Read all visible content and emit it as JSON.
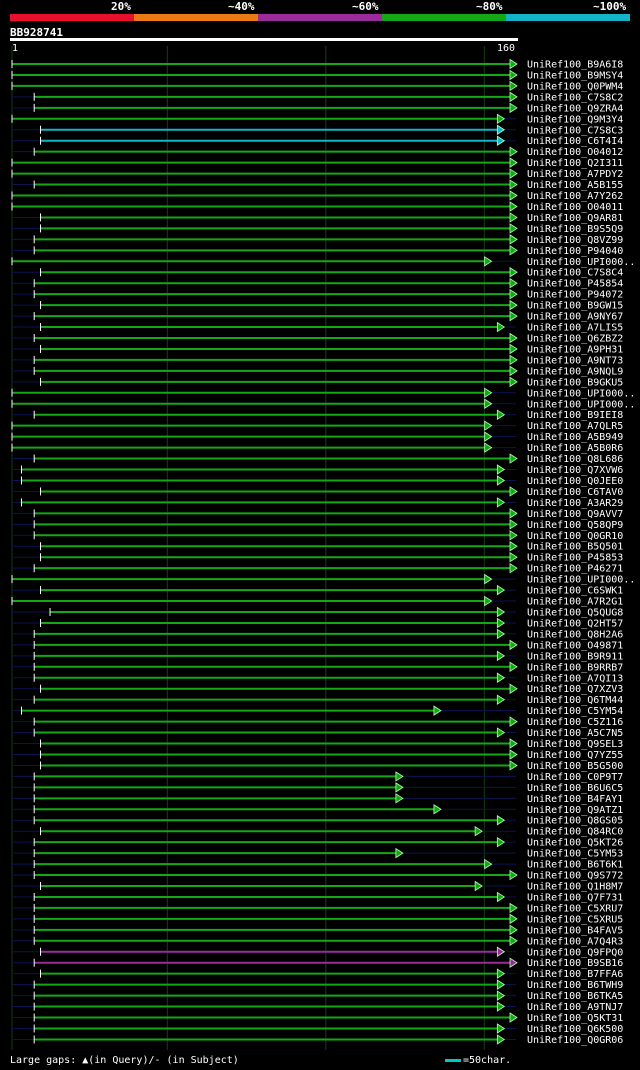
{
  "legend": [
    {
      "label": "20%",
      "color": "#e8102a"
    },
    {
      "label": "~40%",
      "color": "#ec7a14"
    },
    {
      "label": "~60%",
      "color": "#9b2a9b"
    },
    {
      "label": "~80%",
      "color": "#14a814"
    },
    {
      "label": "~100%",
      "color": "#14b4c8"
    }
  ],
  "query": {
    "name": "BB928741",
    "start_label": "1",
    "end_label": "160"
  },
  "footer": {
    "gaps_text": "Large gaps: ▲(in Query)/- (in Subject)",
    "scale_text": "=50char."
  },
  "chart_data": {
    "type": "alignment",
    "query_length": 160,
    "hits": [
      {
        "name": "UniRef100_B9A6I8",
        "start": 1,
        "end": 160,
        "identity": "~80%"
      },
      {
        "name": "UniRef100_B9MSY4",
        "start": 1,
        "end": 160,
        "identity": "~80%"
      },
      {
        "name": "UniRef100_Q0PWM4",
        "start": 1,
        "end": 160,
        "identity": "~80%"
      },
      {
        "name": "UniRef100_C7S8C2",
        "start": 8,
        "end": 160,
        "identity": "~80%"
      },
      {
        "name": "UniRef100_Q9ZRA4",
        "start": 8,
        "end": 160,
        "identity": "~80%"
      },
      {
        "name": "UniRef100_Q9M3Y4",
        "start": 1,
        "end": 156,
        "identity": "~80%"
      },
      {
        "name": "UniRef100_C7S8C3",
        "start": 10,
        "end": 156,
        "identity": "~100%"
      },
      {
        "name": "UniRef100_C6T4I4",
        "start": 10,
        "end": 156,
        "identity": "~100%"
      },
      {
        "name": "UniRef100_O04012",
        "start": 8,
        "end": 160,
        "identity": "~80%"
      },
      {
        "name": "UniRef100_Q2I311",
        "start": 1,
        "end": 160,
        "identity": "~80%"
      },
      {
        "name": "UniRef100_A7PDY2",
        "start": 1,
        "end": 160,
        "identity": "~80%"
      },
      {
        "name": "UniRef100_A5B155",
        "start": 8,
        "end": 160,
        "identity": "~80%"
      },
      {
        "name": "UniRef100_A7Y262",
        "start": 1,
        "end": 160,
        "identity": "~80%"
      },
      {
        "name": "UniRef100_O04011",
        "start": 1,
        "end": 160,
        "identity": "~80%"
      },
      {
        "name": "UniRef100_Q9AR81",
        "start": 10,
        "end": 160,
        "identity": "~80%"
      },
      {
        "name": "UniRef100_B9S5Q9",
        "start": 10,
        "end": 160,
        "identity": "~80%"
      },
      {
        "name": "UniRef100_Q8VZ99",
        "start": 8,
        "end": 160,
        "identity": "~80%"
      },
      {
        "name": "UniRef100_P94040",
        "start": 8,
        "end": 160,
        "identity": "~80%"
      },
      {
        "name": "UniRef100_UPI000..",
        "start": 1,
        "end": 152,
        "identity": "~80%"
      },
      {
        "name": "UniRef100_C7S8C4",
        "start": 10,
        "end": 160,
        "identity": "~80%"
      },
      {
        "name": "UniRef100_P45854",
        "start": 8,
        "end": 160,
        "identity": "~80%"
      },
      {
        "name": "UniRef100_P94072",
        "start": 8,
        "end": 160,
        "identity": "~80%"
      },
      {
        "name": "UniRef100_B9GW15",
        "start": 10,
        "end": 160,
        "identity": "~80%"
      },
      {
        "name": "UniRef100_A9NY67",
        "start": 8,
        "end": 160,
        "identity": "~80%"
      },
      {
        "name": "UniRef100_A7LIS5",
        "start": 10,
        "end": 156,
        "identity": "~80%"
      },
      {
        "name": "UniRef100_Q6ZBZ2",
        "start": 8,
        "end": 160,
        "identity": "~80%"
      },
      {
        "name": "UniRef100_A9PH31",
        "start": 10,
        "end": 160,
        "identity": "~80%"
      },
      {
        "name": "UniRef100_A9NT73",
        "start": 8,
        "end": 160,
        "identity": "~80%"
      },
      {
        "name": "UniRef100_A9NQL9",
        "start": 8,
        "end": 160,
        "identity": "~80%"
      },
      {
        "name": "UniRef100_B9GKU5",
        "start": 10,
        "end": 160,
        "identity": "~80%"
      },
      {
        "name": "UniRef100_UPI000..",
        "start": 1,
        "end": 152,
        "identity": "~80%"
      },
      {
        "name": "UniRef100_UPI000..",
        "start": 1,
        "end": 152,
        "identity": "~80%"
      },
      {
        "name": "UniRef100_B9IEI8",
        "start": 8,
        "end": 156,
        "identity": "~80%"
      },
      {
        "name": "UniRef100_A7QLR5",
        "start": 1,
        "end": 152,
        "identity": "~80%"
      },
      {
        "name": "UniRef100_A5B949",
        "start": 1,
        "end": 152,
        "identity": "~80%"
      },
      {
        "name": "UniRef100_A5B0R6",
        "start": 1,
        "end": 152,
        "identity": "~80%"
      },
      {
        "name": "UniRef100_Q8L686",
        "start": 8,
        "end": 160,
        "identity": "~80%"
      },
      {
        "name": "UniRef100_Q7XVW6",
        "start": 4,
        "end": 156,
        "identity": "~80%"
      },
      {
        "name": "UniRef100_Q0JEE0",
        "start": 4,
        "end": 156,
        "identity": "~80%"
      },
      {
        "name": "UniRef100_C6TAV0",
        "start": 10,
        "end": 160,
        "identity": "~80%"
      },
      {
        "name": "UniRef100_A3AR29",
        "start": 4,
        "end": 156,
        "identity": "~80%"
      },
      {
        "name": "UniRef100_Q9AVV7",
        "start": 8,
        "end": 160,
        "identity": "~80%"
      },
      {
        "name": "UniRef100_Q58QP9",
        "start": 8,
        "end": 160,
        "identity": "~80%"
      },
      {
        "name": "UniRef100_Q0GR10",
        "start": 8,
        "end": 160,
        "identity": "~80%"
      },
      {
        "name": "UniRef100_B5Q501",
        "start": 10,
        "end": 160,
        "identity": "~80%"
      },
      {
        "name": "UniRef100_P45853",
        "start": 10,
        "end": 160,
        "identity": "~80%"
      },
      {
        "name": "UniRef100_P46271",
        "start": 8,
        "end": 160,
        "identity": "~80%"
      },
      {
        "name": "UniRef100_UPI000..",
        "start": 1,
        "end": 152,
        "identity": "~80%"
      },
      {
        "name": "UniRef100_C6SWK1",
        "start": 10,
        "end": 156,
        "identity": "~80%"
      },
      {
        "name": "UniRef100_A7R2G1",
        "start": 1,
        "end": 152,
        "identity": "~80%"
      },
      {
        "name": "UniRef100_Q5QUG8",
        "start": 13,
        "end": 156,
        "identity": "~80%"
      },
      {
        "name": "UniRef100_Q2HT57",
        "start": 10,
        "end": 156,
        "identity": "~80%"
      },
      {
        "name": "UniRef100_Q8H2A6",
        "start": 8,
        "end": 156,
        "identity": "~80%"
      },
      {
        "name": "UniRef100_O49871",
        "start": 8,
        "end": 160,
        "identity": "~80%"
      },
      {
        "name": "UniRef100_B9R911",
        "start": 8,
        "end": 156,
        "identity": "~80%"
      },
      {
        "name": "UniRef100_B9RRB7",
        "start": 8,
        "end": 160,
        "identity": "~80%"
      },
      {
        "name": "UniRef100_A7QI13",
        "start": 8,
        "end": 156,
        "identity": "~80%"
      },
      {
        "name": "UniRef100_Q7XZV3",
        "start": 10,
        "end": 160,
        "identity": "~80%"
      },
      {
        "name": "UniRef100_Q6TM44",
        "start": 8,
        "end": 156,
        "identity": "~80%"
      },
      {
        "name": "UniRef100_C5YM54",
        "start": 4,
        "end": 136,
        "identity": "~80%"
      },
      {
        "name": "UniRef100_C5Z116",
        "start": 8,
        "end": 160,
        "identity": "~80%"
      },
      {
        "name": "UniRef100_A5C7N5",
        "start": 8,
        "end": 156,
        "identity": "~80%"
      },
      {
        "name": "UniRef100_Q9SEL3",
        "start": 10,
        "end": 160,
        "identity": "~80%"
      },
      {
        "name": "UniRef100_Q7YZ55",
        "start": 10,
        "end": 160,
        "identity": "~80%"
      },
      {
        "name": "UniRef100_B5G500",
        "start": 10,
        "end": 160,
        "identity": "~80%"
      },
      {
        "name": "UniRef100_C0P9T7",
        "start": 8,
        "end": 124,
        "identity": "~80%"
      },
      {
        "name": "UniRef100_B6U6C5",
        "start": 8,
        "end": 124,
        "identity": "~80%"
      },
      {
        "name": "UniRef100_B4FAY1",
        "start": 8,
        "end": 124,
        "identity": "~80%"
      },
      {
        "name": "UniRef100_Q9ATZ1",
        "start": 8,
        "end": 136,
        "identity": "~80%"
      },
      {
        "name": "UniRef100_Q8GS05",
        "start": 8,
        "end": 156,
        "identity": "~80%"
      },
      {
        "name": "UniRef100_Q84RC0",
        "start": 10,
        "end": 149,
        "identity": "~80%"
      },
      {
        "name": "UniRef100_Q5KT26",
        "start": 8,
        "end": 156,
        "identity": "~80%"
      },
      {
        "name": "UniRef100_C5YM53",
        "start": 8,
        "end": 124,
        "identity": "~80%"
      },
      {
        "name": "UniRef100_B6T6K1",
        "start": 8,
        "end": 152,
        "identity": "~80%"
      },
      {
        "name": "UniRef100_Q9S772",
        "start": 8,
        "end": 160,
        "identity": "~80%"
      },
      {
        "name": "UniRef100_Q1H8M7",
        "start": 10,
        "end": 149,
        "identity": "~80%"
      },
      {
        "name": "UniRef100_Q7F731",
        "start": 8,
        "end": 156,
        "identity": "~80%"
      },
      {
        "name": "UniRef100_C5XRU7",
        "start": 8,
        "end": 160,
        "identity": "~80%"
      },
      {
        "name": "UniRef100_C5XRU5",
        "start": 8,
        "end": 160,
        "identity": "~80%"
      },
      {
        "name": "UniRef100_B4FAV5",
        "start": 8,
        "end": 160,
        "identity": "~80%"
      },
      {
        "name": "UniRef100_A7Q4R3",
        "start": 8,
        "end": 160,
        "identity": "~80%"
      },
      {
        "name": "UniRef100_Q9FPQ0",
        "start": 10,
        "end": 156,
        "identity": "~60%"
      },
      {
        "name": "UniRef100_B9SB16",
        "start": 8,
        "end": 160,
        "identity": "~60%"
      },
      {
        "name": "UniRef100_B7FFA6",
        "start": 10,
        "end": 156,
        "identity": "~80%"
      },
      {
        "name": "UniRef100_B6TWH9",
        "start": 8,
        "end": 156,
        "identity": "~80%"
      },
      {
        "name": "UniRef100_B6TKA5",
        "start": 8,
        "end": 156,
        "identity": "~80%"
      },
      {
        "name": "UniRef100_A9TNJ7",
        "start": 8,
        "end": 156,
        "identity": "~80%"
      },
      {
        "name": "UniRef100_Q5KT31",
        "start": 8,
        "end": 160,
        "identity": "~80%"
      },
      {
        "name": "UniRef100_Q6K500",
        "start": 8,
        "end": 156,
        "identity": "~80%"
      },
      {
        "name": "UniRef100_Q0GR06",
        "start": 8,
        "end": 156,
        "identity": "~80%"
      }
    ]
  }
}
